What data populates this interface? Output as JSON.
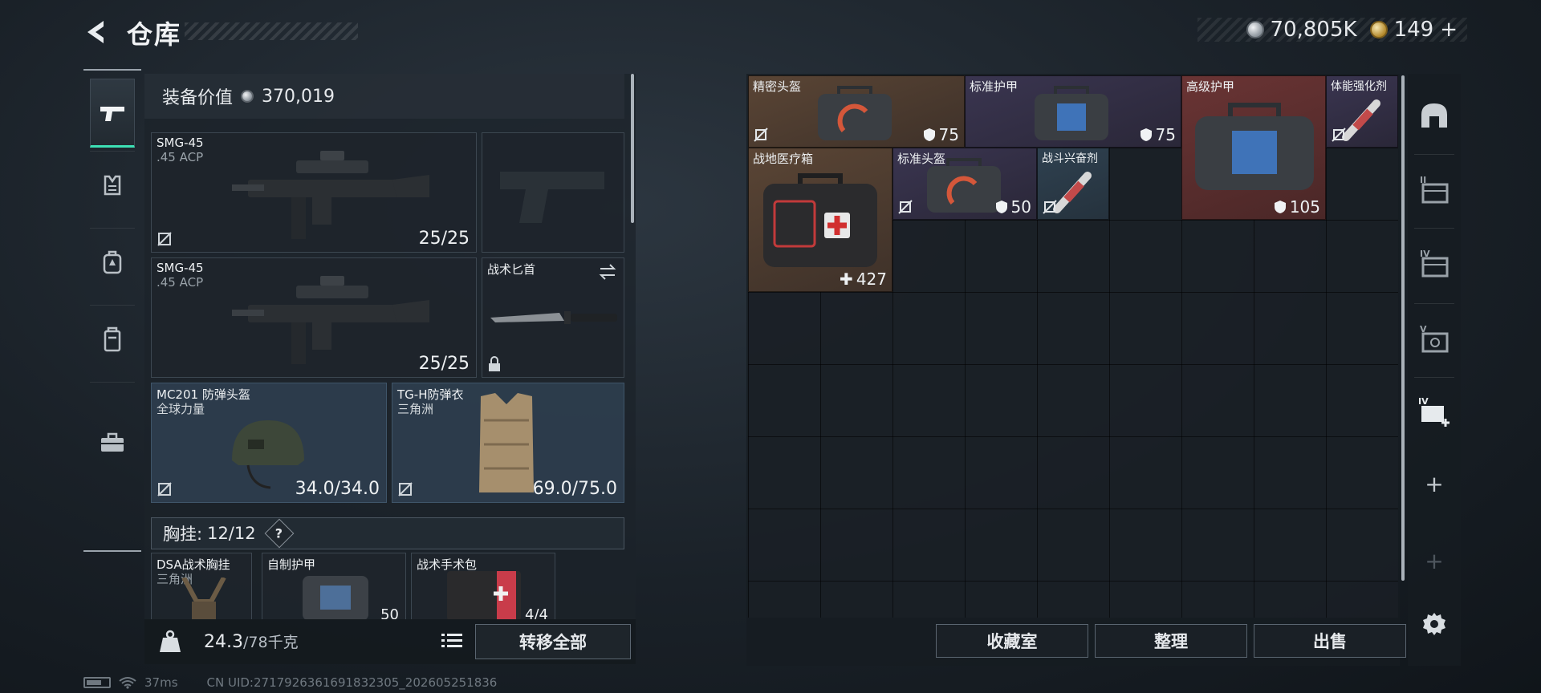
{
  "header": {
    "title": "仓库",
    "currency_silver": "70,805K",
    "currency_gold": "149",
    "gold_suffix": "+"
  },
  "left_tabs": [
    {
      "id": "weapons",
      "icon": "pistol-icon",
      "active": true
    },
    {
      "id": "armor",
      "icon": "vest-icon",
      "active": false
    },
    {
      "id": "backpack",
      "icon": "backpack-icon",
      "active": false
    },
    {
      "id": "container",
      "icon": "canister-icon",
      "active": false
    },
    {
      "id": "kit",
      "icon": "toolbox-icon",
      "active": false
    }
  ],
  "equipment": {
    "value_label": "装备价值",
    "value": "370,019",
    "primary1": {
      "name": "SMG-45",
      "ammo": ".45 ACP",
      "count": "25/25"
    },
    "primary2": {
      "name": "SMG-45",
      "ammo": ".45 ACP",
      "count": "25/25"
    },
    "melee": {
      "name": "战术匕首"
    },
    "helmet": {
      "name": "MC201 防弹头盔",
      "brand": "全球力量",
      "durability": "34.0/34.0"
    },
    "armor": {
      "name": "TG-H防弹衣",
      "brand": "三角洲",
      "durability": "69.0/75.0"
    },
    "chest_label": "胸挂:",
    "chest_value": "12/12",
    "help": "?",
    "rig": {
      "name": "DSA战术胸挂",
      "brand": "三角洲"
    },
    "rig_item2": {
      "name": "自制护甲",
      "value": "50"
    },
    "rig_item3": {
      "name": "战术手术包",
      "value": "4/4"
    }
  },
  "weight": {
    "current": "24.3",
    "max_unit": "/78千克"
  },
  "transfer_label": "转移全部",
  "storage_items": [
    {
      "name": "精密头盔",
      "value": "75",
      "tier": "orange",
      "kind": "bag"
    },
    {
      "name": "标准护甲",
      "value": "75",
      "tier": "purple",
      "kind": "bag"
    },
    {
      "name": "高级护甲",
      "value": "105",
      "tier": "red",
      "kind": "bag"
    },
    {
      "name": "体能强化剂",
      "value": "",
      "tier": "purple",
      "kind": "syringe"
    },
    {
      "name": "战地医疗箱",
      "value": "427",
      "tier": "orange",
      "kind": "medkit"
    },
    {
      "name": "标准头盔",
      "value": "50",
      "tier": "purple",
      "kind": "bag"
    },
    {
      "name": "战斗兴奋剂",
      "value": "",
      "tier": "blue",
      "kind": "syringe"
    }
  ],
  "storage_buttons": {
    "collection": "收藏室",
    "sort": "整理",
    "sell": "出售"
  },
  "right_tabs": [
    "helmet-tab-icon",
    "crate-2-icon",
    "crate-4-icon",
    "crate-5-icon",
    "add-crate-4-icon"
  ],
  "status": {
    "ping": "37ms",
    "uid": "CN UID:2717926361691832305_202605251836"
  },
  "colors": {
    "accent": "#3de0b5"
  }
}
